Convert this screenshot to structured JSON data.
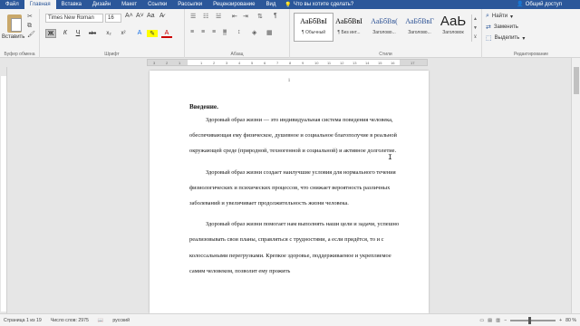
{
  "tabs": [
    "Файл",
    "Главная",
    "Вставка",
    "Дизайн",
    "Макет",
    "Ссылки",
    "Рассылки",
    "Рецензирование",
    "Вид"
  ],
  "tell_me": "Что вы хотите сделать?",
  "share": "Общий доступ",
  "clipboard": {
    "paste_label": "Вставить",
    "group_label": "Буфер обмена"
  },
  "font": {
    "name": "Times New Roman",
    "size": "16",
    "group_label": "Шрифт",
    "bold": "Ж",
    "italic": "К",
    "underline": "Ч",
    "strike": "abc",
    "sub": "x₂",
    "sup": "x²"
  },
  "paragraph": {
    "group_label": "Абзац",
    "pilcrow": "¶"
  },
  "styles": {
    "group_label": "Стили",
    "items": [
      {
        "sample": "АаБбВвІ",
        "name": "¶ Обычный",
        "kind": "normal"
      },
      {
        "sample": "АаБбВвІ",
        "name": "¶ Без инт...",
        "kind": "normal"
      },
      {
        "sample": "АаБбВв(",
        "name": "Заголово...",
        "kind": "h"
      },
      {
        "sample": "АаБбВвГ",
        "name": "Заголово...",
        "kind": "h"
      },
      {
        "sample": "АаЬ",
        "name": "Заголовок",
        "kind": "big"
      }
    ]
  },
  "editing": {
    "find": "Найти",
    "replace": "Заменить",
    "select": "Выделить",
    "group_label": "Редактирование"
  },
  "ruler": {
    "ticks": [
      "3",
      "2",
      "1",
      "1",
      "2",
      "3",
      "4",
      "5",
      "6",
      "7",
      "8",
      "9",
      "10",
      "11",
      "12",
      "13",
      "14",
      "15",
      "16",
      "17"
    ]
  },
  "document": {
    "page_number": "1",
    "heading": "Введение.",
    "paragraphs": [
      "Здоровый образ жизни — это индивидуальная система поведения человека, обеспечивающая ему физическое, душевное и социальное благополучие в реальной окружающей среде (природной, техногенной и социальной) и активное долголетие.",
      "Здоровый образ жизни создает наилучшие условия для нормального течения физиологических и психических процессов, что снижает вероятность различных заболеваний и увеличивает продолжительность жизни человека.",
      "Здоровый образ жизни помогает нам выполнять наши цели и задачи, успешно реализовывать свои планы, справляться с трудностями, а если придётся, то и с колоссальными перегрузками. Крепкое здоровье, поддерживаемое и укрепляемое самим человеком, позволит ему прожить"
    ]
  },
  "status": {
    "page": "Страница 1 из 19",
    "words": "Число слов: 2975",
    "lang": "русский",
    "zoom": "80 %"
  },
  "accent": "#2b579a"
}
